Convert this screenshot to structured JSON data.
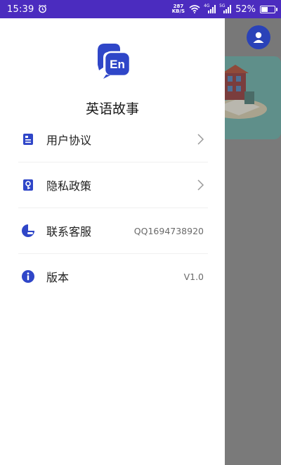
{
  "status_bar": {
    "time": "15:39",
    "net_speed_top": "287",
    "net_speed_bottom": "KB/S",
    "signal_1": "4G",
    "signal_2": "5G",
    "battery": "52%",
    "battery_level": 0.52
  },
  "drawer": {
    "app_title": "英语故事",
    "logo_text": "En",
    "items": [
      {
        "label": "用户协议",
        "value": "",
        "icon": "document-icon",
        "has_chevron": true
      },
      {
        "label": "隐私政策",
        "value": "",
        "icon": "key-icon",
        "has_chevron": true
      },
      {
        "label": "联系客服",
        "value": "QQ1694738920",
        "icon": "customer-service-icon",
        "has_chevron": false
      },
      {
        "label": "版本",
        "value": "V1.0",
        "icon": "info-icon",
        "has_chevron": false
      }
    ]
  },
  "colors": {
    "accent": "#2f46c8",
    "status_bar": "#4b2cbf",
    "dim_overlay": "#7a7a7a"
  }
}
